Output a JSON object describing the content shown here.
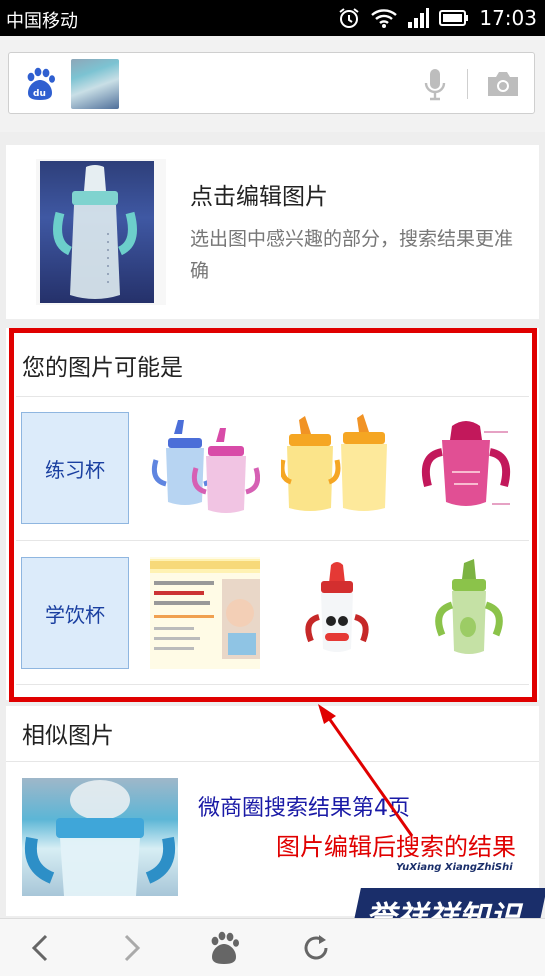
{
  "status_bar": {
    "carrier": "中国移动",
    "time": "17:03",
    "icons": [
      "alarm-icon",
      "wifi-icon",
      "signal-icon",
      "battery-icon"
    ]
  },
  "search_bar": {
    "logo": "du",
    "icons": [
      "baidu-paw-icon",
      "microphone-icon",
      "camera-icon"
    ]
  },
  "edit_card": {
    "title": "点击编辑图片",
    "description": "选出图中感兴趣的部分，搜索结果更准确"
  },
  "guess_section": {
    "title": "您的图片可能是",
    "rows": [
      {
        "tag": "练习杯"
      },
      {
        "tag": "学饮杯"
      }
    ]
  },
  "similar_section": {
    "title": "相似图片",
    "items": [
      {
        "title": "微商圈搜索结果第4页"
      }
    ]
  },
  "annotation": {
    "text": "图片编辑后搜索的结果"
  },
  "watermark": {
    "english": "YuXiang XiangZhiShi",
    "chinese": "誉祥祥知识"
  },
  "bottom_nav": {
    "icons": [
      "back-icon",
      "forward-icon",
      "baidu-home-icon",
      "refresh-icon"
    ]
  },
  "colors": {
    "annotation_red": "#e00000",
    "tag_bg": "#dcebfa",
    "link_blue": "#1a1aa6",
    "watermark_blue": "#1a2e6a"
  }
}
